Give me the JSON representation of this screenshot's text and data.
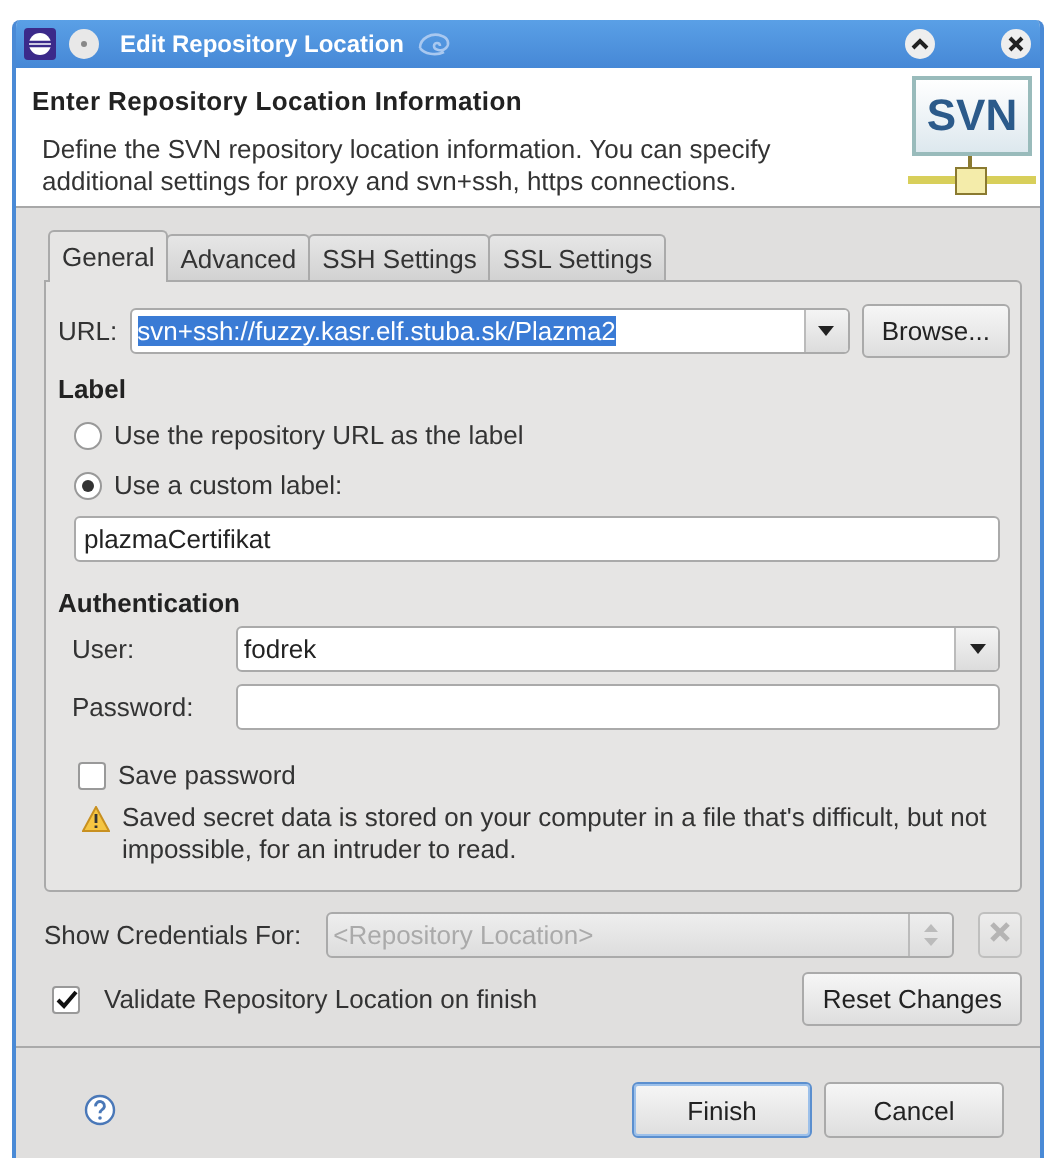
{
  "window": {
    "title": "Edit Repository Location"
  },
  "header": {
    "title": "Enter Repository Location Information",
    "description": "Define the SVN repository location information. You can specify additional settings for proxy and svn+ssh, https connections.",
    "logo": "SVN"
  },
  "tabs": [
    {
      "label": "General",
      "selected": true
    },
    {
      "label": "Advanced",
      "selected": false
    },
    {
      "label": "SSH Settings",
      "selected": false
    },
    {
      "label": "SSL Settings",
      "selected": false
    }
  ],
  "url": {
    "label": "URL:",
    "value": "svn+ssh://fuzzy.kasr.elf.stuba.sk/Plazma2",
    "highlighted": true
  },
  "browse_button": {
    "label": "Browse..."
  },
  "label_section": {
    "title": "Label",
    "options": [
      {
        "label": "Use the repository URL as the label",
        "selected": false
      },
      {
        "label": "Use a custom label:",
        "selected": true
      }
    ],
    "custom_label": "plazmaCertifikat"
  },
  "authentication": {
    "title": "Authentication",
    "user": {
      "label": "User:",
      "value": "fodrek"
    },
    "password": {
      "label": "Password:"
    },
    "save_password": {
      "label": "Save password",
      "checked": false
    },
    "warning": "Saved secret data is stored on your computer in a file that's difficult, but not impossible, for an intruder to read."
  },
  "credentials": {
    "label": "Show Credentials For:",
    "value": "<Repository Location>",
    "disabled": true
  },
  "validate": {
    "label": "Validate Repository Location on finish",
    "checked": true
  },
  "reset_button": {
    "label": "Reset Changes"
  },
  "buttons": [
    {
      "label": "Finish",
      "default": true
    },
    {
      "label": "Cancel",
      "default": false
    }
  ]
}
